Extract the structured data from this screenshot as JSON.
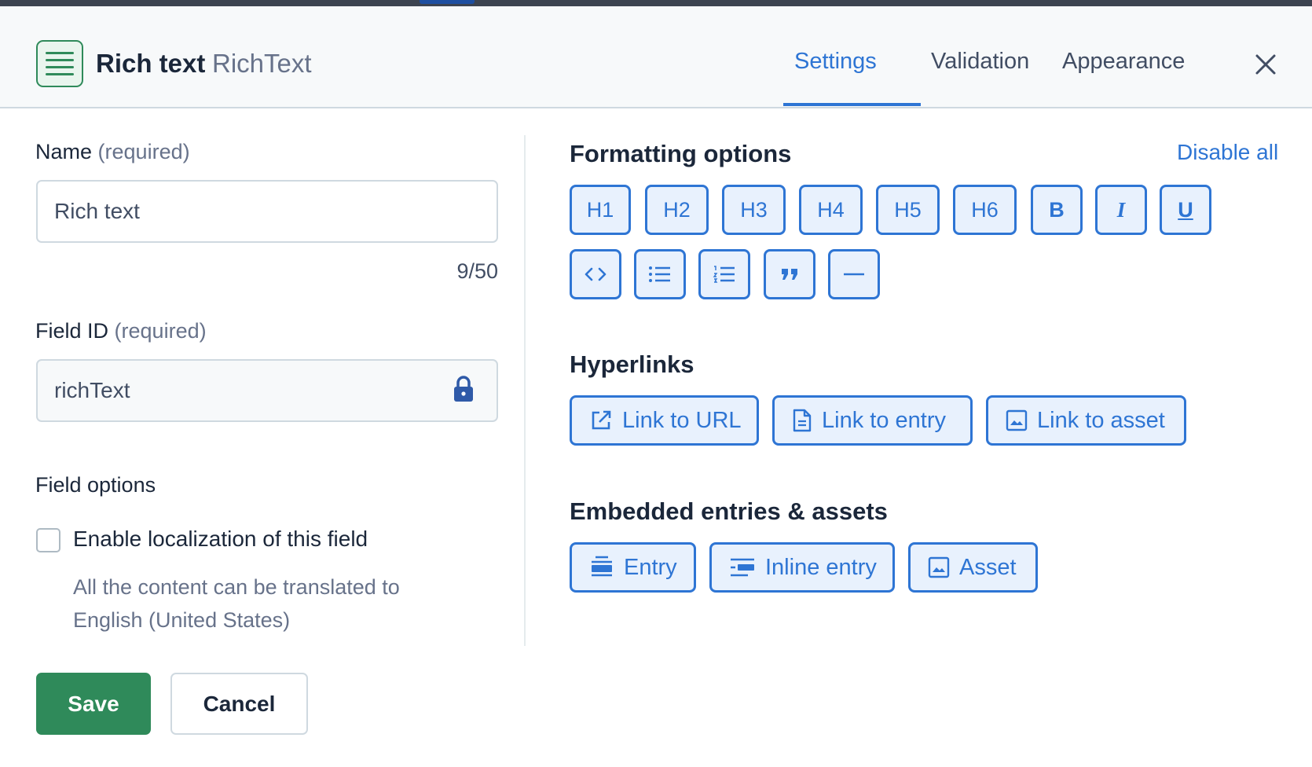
{
  "header": {
    "title": "Rich text",
    "subtitle": "RichText",
    "tabs": [
      {
        "label": "Settings",
        "active": true
      },
      {
        "label": "Validation",
        "active": false
      },
      {
        "label": "Appearance",
        "active": false
      }
    ]
  },
  "left": {
    "name_label": "Name",
    "name_required": "(required)",
    "name_value": "Rich text",
    "name_counter": "9/50",
    "fieldid_label": "Field ID",
    "fieldid_required": "(required)",
    "fieldid_value": "richText",
    "field_options_title": "Field options",
    "localization_label": "Enable localization of this field",
    "localization_help": "All the content can be translated to English (United States)",
    "localization_checked": false,
    "save_label": "Save",
    "cancel_label": "Cancel"
  },
  "formatting": {
    "title": "Formatting options",
    "disable_all": "Disable all",
    "headings": [
      "H1",
      "H2",
      "H3",
      "H4",
      "H5",
      "H6"
    ],
    "marks": [
      "B",
      "I",
      "U"
    ],
    "blocks": [
      "code-icon",
      "bulleted-list-icon",
      "numbered-list-icon",
      "quote-icon",
      "horizontal-rule-icon"
    ]
  },
  "hyperlinks": {
    "title": "Hyperlinks",
    "items": [
      "Link to URL",
      "Link to entry",
      "Link to asset"
    ]
  },
  "embedded": {
    "title": "Embedded entries & assets",
    "items": [
      "Entry",
      "Inline entry",
      "Asset"
    ]
  },
  "colors": {
    "accent": "#2e75d4",
    "brand_green": "#2f8a5a",
    "text_primary": "#1b273a",
    "text_secondary": "#67728a"
  }
}
